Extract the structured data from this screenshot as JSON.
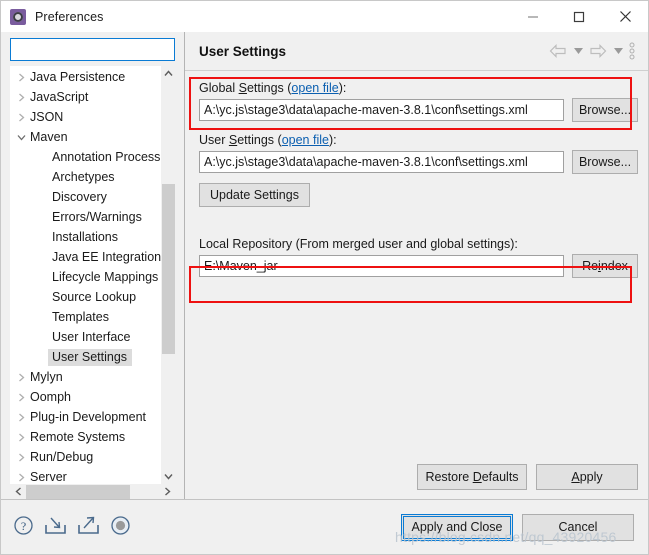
{
  "window": {
    "title": "Preferences",
    "icon": "gear-icon",
    "buttons": {
      "minimize": "minimize-icon",
      "maximize": "maximize-icon",
      "close": "close-icon"
    }
  },
  "sidebar": {
    "search": {
      "value": "",
      "placeholder": ""
    },
    "items": [
      {
        "label": "Java Persistence",
        "level": 0,
        "twisty": "collapsed",
        "selected": false
      },
      {
        "label": "JavaScript",
        "level": 0,
        "twisty": "collapsed",
        "selected": false
      },
      {
        "label": "JSON",
        "level": 0,
        "twisty": "collapsed",
        "selected": false
      },
      {
        "label": "Maven",
        "level": 0,
        "twisty": "expanded",
        "selected": false
      },
      {
        "label": "Annotation Process",
        "level": 1,
        "twisty": "none",
        "selected": false
      },
      {
        "label": "Archetypes",
        "level": 1,
        "twisty": "none",
        "selected": false
      },
      {
        "label": "Discovery",
        "level": 1,
        "twisty": "none",
        "selected": false
      },
      {
        "label": "Errors/Warnings",
        "level": 1,
        "twisty": "none",
        "selected": false
      },
      {
        "label": "Installations",
        "level": 1,
        "twisty": "none",
        "selected": false
      },
      {
        "label": "Java EE Integration",
        "level": 1,
        "twisty": "none",
        "selected": false
      },
      {
        "label": "Lifecycle Mappings",
        "level": 1,
        "twisty": "none",
        "selected": false
      },
      {
        "label": "Source Lookup",
        "level": 1,
        "twisty": "none",
        "selected": false
      },
      {
        "label": "Templates",
        "level": 1,
        "twisty": "none",
        "selected": false
      },
      {
        "label": "User Interface",
        "level": 1,
        "twisty": "none",
        "selected": false
      },
      {
        "label": "User Settings",
        "level": 1,
        "twisty": "none",
        "selected": true
      },
      {
        "label": "Mylyn",
        "level": 0,
        "twisty": "collapsed",
        "selected": false
      },
      {
        "label": "Oomph",
        "level": 0,
        "twisty": "collapsed",
        "selected": false
      },
      {
        "label": "Plug-in Development",
        "level": 0,
        "twisty": "collapsed",
        "selected": false
      },
      {
        "label": "Remote Systems",
        "level": 0,
        "twisty": "collapsed",
        "selected": false
      },
      {
        "label": "Run/Debug",
        "level": 0,
        "twisty": "collapsed",
        "selected": false
      },
      {
        "label": "Server",
        "level": 0,
        "twisty": "collapsed",
        "selected": false
      }
    ]
  },
  "page": {
    "title": "User Settings",
    "nav": {
      "back": "back-arrow-icon",
      "back_caret": "chevron-down-icon",
      "forward": "forward-arrow-icon",
      "forward_caret": "chevron-down-icon",
      "menu": "vertical-dots-icon"
    },
    "global_settings": {
      "label_prefix": "Global ",
      "label_accel": "S",
      "label_mid": "ettings (",
      "link": "open file",
      "label_suffix": "):",
      "value": "A:\\yc.js\\stage3\\data\\apache-maven-3.8.1\\conf\\settings.xml",
      "browse_label": "Browse..."
    },
    "user_settings": {
      "label_prefix": "User ",
      "label_accel": "S",
      "label_mid": "ettings (",
      "link": "open file",
      "label_suffix": "):",
      "value": "A:\\yc.js\\stage3\\data\\apache-maven-3.8.1\\conf\\settings.xml",
      "browse_label": "Browse..."
    },
    "update_settings_label": "Update Settings",
    "local_repository": {
      "label": "Local Repository (From merged user and global settings):",
      "value": "E:\\Maven_jar",
      "reindex_prefix": "Re",
      "reindex_accel": "i",
      "reindex_suffix": "ndex"
    },
    "restore_defaults": {
      "prefix": "Restore ",
      "accel": "D",
      "suffix": "efaults"
    },
    "apply": {
      "prefix": "",
      "accel": "A",
      "suffix": "pply"
    }
  },
  "footer": {
    "icons": [
      {
        "name": "help-icon"
      },
      {
        "name": "import-icon"
      },
      {
        "name": "export-icon"
      },
      {
        "name": "record-icon"
      }
    ],
    "apply_and_close_label": "Apply and Close",
    "cancel_label": "Cancel"
  },
  "watermark": "https://blog.csdn.net/qq_43920456",
  "colors": {
    "accent": "#0a7bd4",
    "annotation": "#ee1111",
    "link": "#0b5fb0",
    "selection": "#dcdcdc"
  }
}
